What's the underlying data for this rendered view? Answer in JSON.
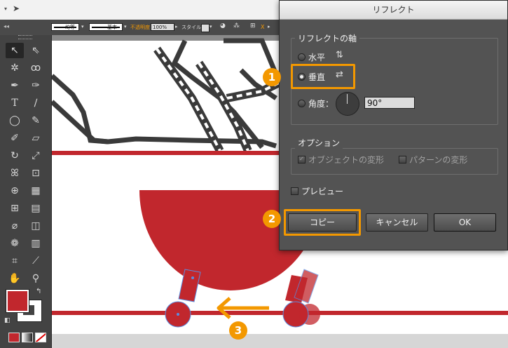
{
  "control_bar": {
    "stroke_label": "均等",
    "brush_label": "基本",
    "opacity_label": "不透明度：",
    "opacity_value": "100%",
    "style_label": "スタイル："
  },
  "colors": {
    "accent": "#f39800",
    "shape_red": "#c1272d"
  },
  "dialog": {
    "title": "リフレクト",
    "axis_group": "リフレクトの軸",
    "horizontal": "水平",
    "vertical": "垂直",
    "angle_label": "角度：",
    "angle_value": "90°",
    "options_group": "オプション",
    "transform_objects": "オブジェクトの変形",
    "transform_patterns": "パターンの変形",
    "preview": "プレビュー",
    "copy_button": "コピー",
    "cancel_button": "キャンセル",
    "ok_button": "OK"
  },
  "annotations": {
    "step1": "1",
    "step2": "2",
    "step3": "3"
  },
  "icons": [
    "selection-tool-icon",
    "direct-selection-tool-icon",
    "magic-wand-icon",
    "lasso-icon",
    "pen-icon",
    "curvature-icon",
    "type-icon",
    "line-icon",
    "ellipse-icon",
    "paintbrush-icon",
    "blob-brush-icon",
    "eraser-icon",
    "rotate-icon",
    "scale-icon",
    "warp-icon",
    "free-transform-icon",
    "shape-builder-icon",
    "perspective-grid-icon",
    "mesh-icon",
    "gradient-icon",
    "eyedropper-icon",
    "blend-icon",
    "symbol-sprayer-icon",
    "column-graph-icon",
    "artboard-icon",
    "slice-icon",
    "hand-icon",
    "zoom-icon"
  ]
}
